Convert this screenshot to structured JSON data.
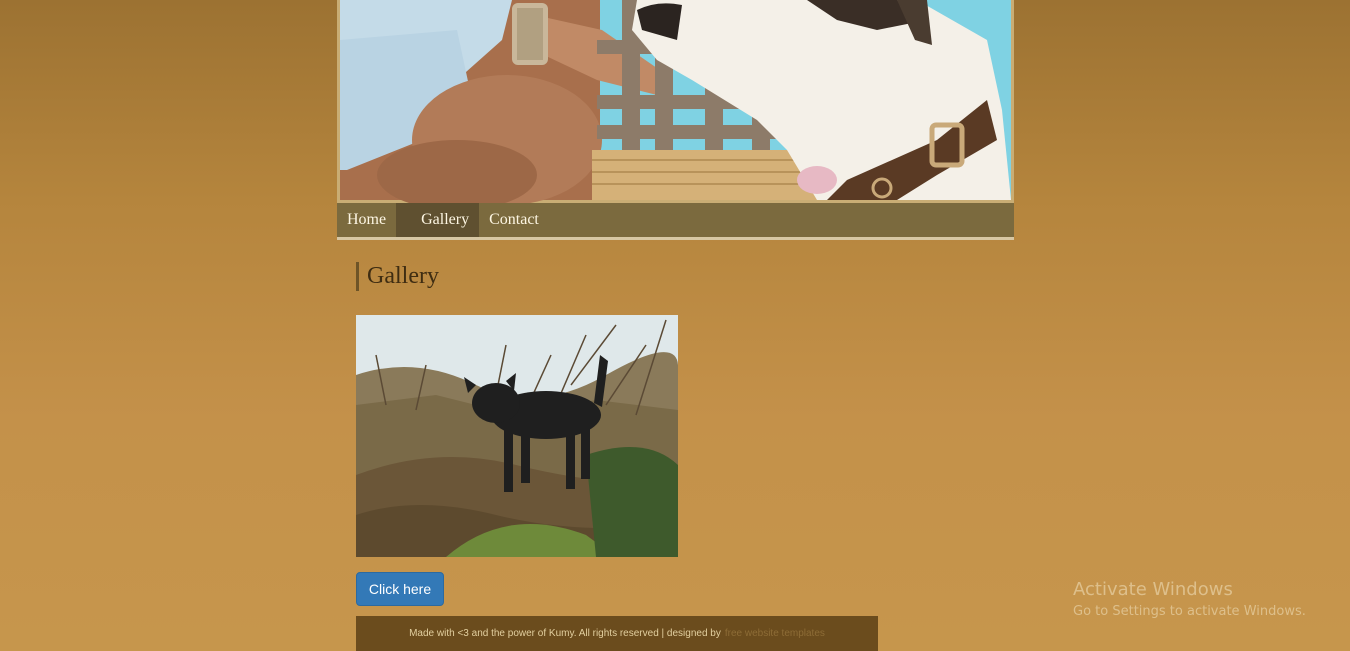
{
  "header": {
    "image_alt": "Woman feeding a white dog with brown collar"
  },
  "nav": {
    "items": [
      {
        "label": "Home",
        "active": false
      },
      {
        "label": "Gallery",
        "active": true
      },
      {
        "label": "Contact",
        "active": false
      }
    ]
  },
  "main": {
    "title": "Gallery",
    "photo_alt": "Black dog standing on a dirt mound",
    "button_label": "Click here"
  },
  "footer": {
    "text": "Made with <3 and the power of Kumy. All rights reserved | designed by",
    "link_text": "free website templates"
  },
  "watermark": {
    "title": "Activate Windows",
    "subtitle": "Go to Settings to activate Windows."
  },
  "colors": {
    "nav_bg": "#7b6a3e",
    "nav_active_bg": "#5f5030",
    "button_bg": "#3379b7",
    "footer_bg": "#6b4c1d"
  }
}
